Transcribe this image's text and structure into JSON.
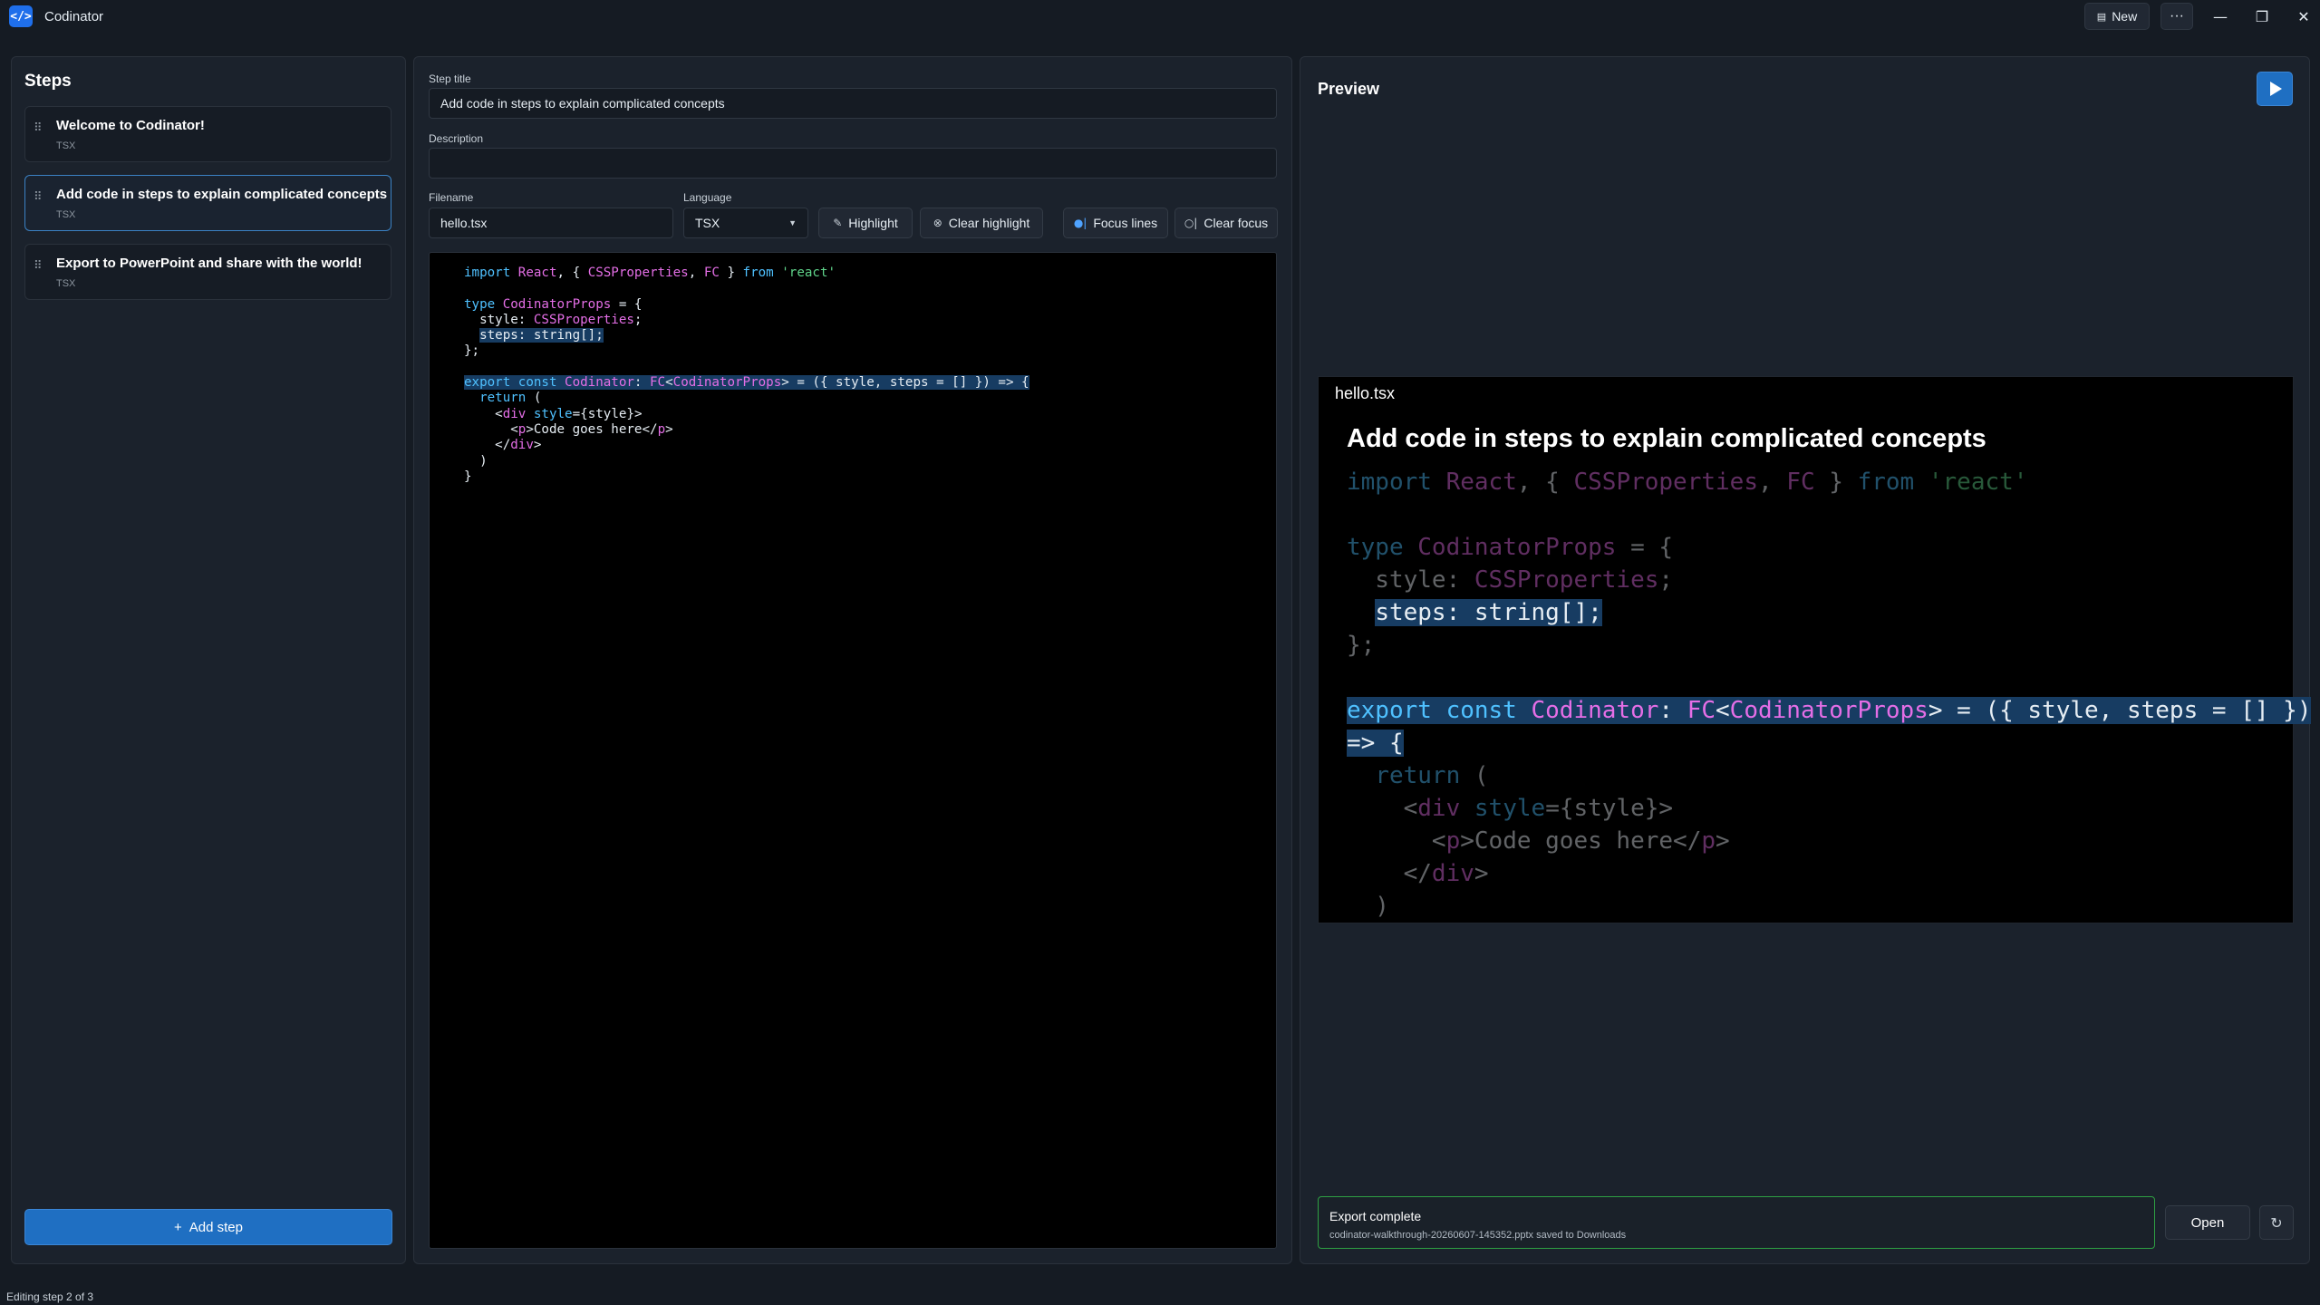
{
  "app": {
    "title": "Codinator",
    "icon_glyph": "</>",
    "new_label": "New",
    "more_glyph": "···"
  },
  "window_controls": {
    "minimize": "—",
    "maximize": "❐",
    "close": "✕"
  },
  "steps": {
    "heading": "Steps",
    "items": [
      {
        "title": "Welcome to Codinator!",
        "language": "TSX",
        "active": false
      },
      {
        "title": "Add code in steps to explain complicated concepts",
        "language": "TSX",
        "active": true
      },
      {
        "title": "Export to PowerPoint and share with the world!",
        "language": "TSX",
        "active": false
      }
    ],
    "add_label": "Add step"
  },
  "editor": {
    "step_title_label": "Step title",
    "step_title_value": "Add code in steps to explain complicated concepts",
    "description_label": "Description",
    "description_value": "",
    "filename_label": "Filename",
    "filename_value": "hello.tsx",
    "language_label": "Language",
    "language_value": "TSX",
    "buttons": {
      "highlight": "Highlight",
      "clear_highlight": "Clear highlight",
      "focus_lines": "Focus lines",
      "clear_focus": "Clear focus"
    }
  },
  "preview": {
    "heading": "Preview",
    "slide_filename": "hello.tsx",
    "slide_title": "Add code in steps to explain complicated concepts"
  },
  "toast": {
    "title": "Export complete",
    "message": "codinator-walkthrough-20260607-145352.pptx saved to Downloads",
    "open_label": "Open"
  },
  "status": "Editing step 2 of 3",
  "colors": {
    "accent": "#1f6fc2",
    "keyword": "#4fc1ff",
    "type": "#e46ee6",
    "string": "#5fd38a",
    "highlight_bg": "#173c62",
    "success_border": "#2ea043"
  }
}
